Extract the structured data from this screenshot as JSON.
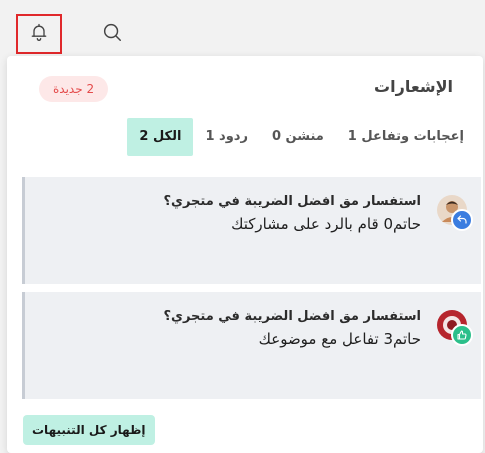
{
  "header": {
    "bell_icon": "bell-icon",
    "search_icon": "search-icon",
    "highlight_color": "#e0282b"
  },
  "panel": {
    "title": "الإشعارات",
    "new_badge": "2 جديدة"
  },
  "tabs": [
    {
      "label": "الكل 2",
      "active": true
    },
    {
      "label": "ردود 1",
      "active": false
    },
    {
      "label": "منشن 0",
      "active": false
    },
    {
      "label": "إعجابات وتفاعل 1",
      "active": false
    }
  ],
  "notifications": [
    {
      "title": "استفسار مق افضل الضريبة في متجري؟",
      "message": "حاتم0 قام بالرد على مشاركتك",
      "type_icon": "reply-icon",
      "badge_color": "#3b7de0"
    },
    {
      "title": "استفسار مق افضل الضريبة في متجري؟",
      "message": "حاتم3 تفاعل مع موضوعك",
      "type_icon": "thumbs-up-icon",
      "badge_color": "#2bbf8a"
    }
  ],
  "footer": {
    "show_all_label": "إظهار كل التنبيهات"
  },
  "colors": {
    "accent": "#bff0e3",
    "badge_bg": "#fde8e8",
    "badge_text": "#e44b4b"
  }
}
